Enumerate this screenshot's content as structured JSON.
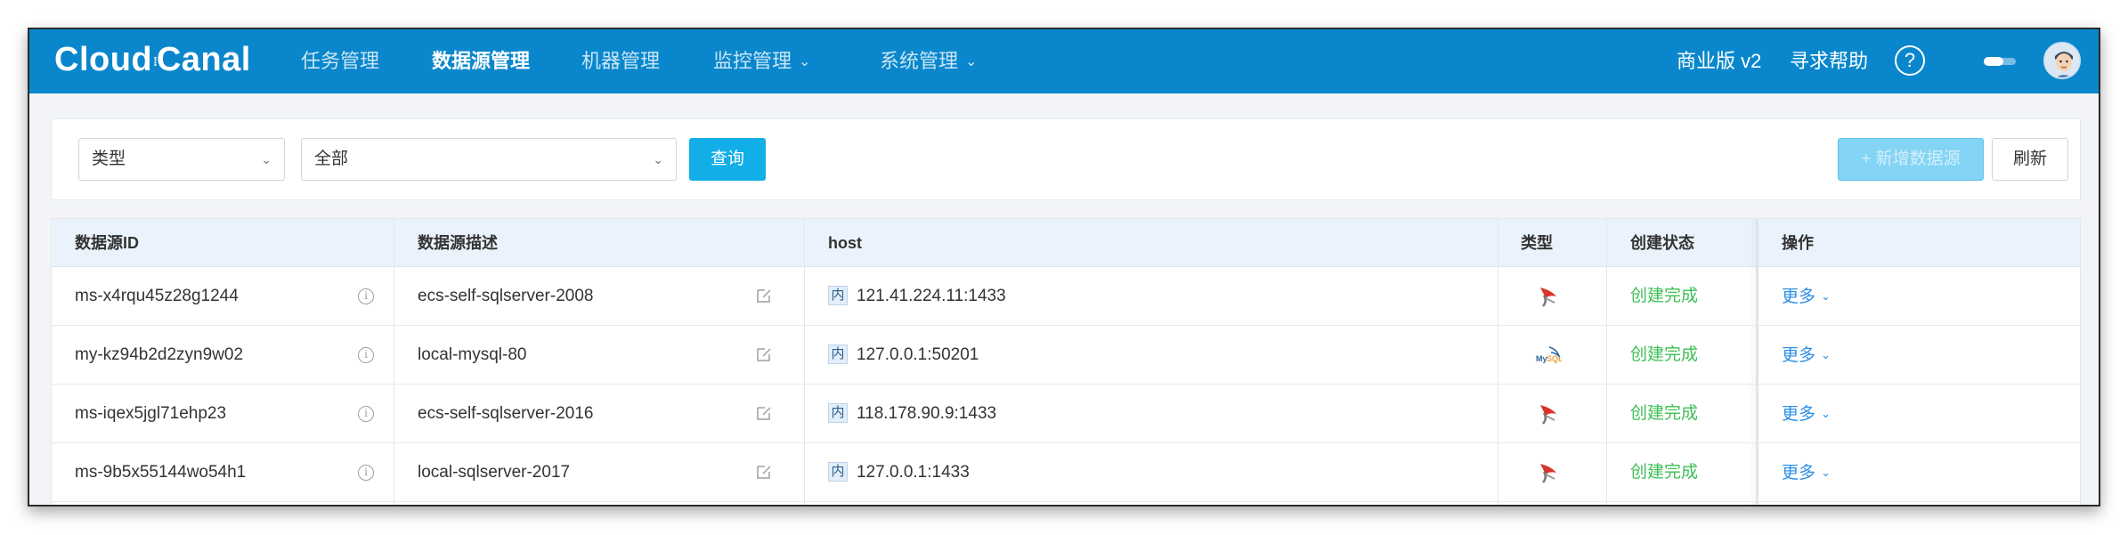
{
  "app": {
    "logo": "Cloud:Canal",
    "logo_left": "Cloud",
    "logo_right": "Canal"
  },
  "nav": {
    "items": [
      {
        "label": "任务管理",
        "active": false,
        "dropdown": false
      },
      {
        "label": "数据源管理",
        "active": true,
        "dropdown": false
      },
      {
        "label": "机器管理",
        "active": false,
        "dropdown": false
      },
      {
        "label": "监控管理",
        "active": false,
        "dropdown": true
      },
      {
        "label": "系统管理",
        "active": false,
        "dropdown": true
      }
    ],
    "edition": "商业版 v2",
    "help": "寻求帮助",
    "help_icon": "?"
  },
  "filter": {
    "type_select": "类型",
    "value_select": "全部",
    "query_button": "查询",
    "add_button": "+ 新增数据源",
    "refresh_button": "刷新"
  },
  "table": {
    "headers": {
      "id": "数据源ID",
      "desc": "数据源描述",
      "host": "host",
      "type": "类型",
      "status": "创建状态",
      "ops": "操作"
    },
    "rows": [
      {
        "id": "ms-x4rqu45z28g1244",
        "desc": "ecs-self-sqlserver-2008",
        "host_tag": "内",
        "host": "121.41.224.11:1433",
        "type_icon": "sqlserver-icon",
        "status": "创建完成",
        "ops": "更多"
      },
      {
        "id": "my-kz94b2d2zyn9w02",
        "desc": "local-mysql-80",
        "host_tag": "内",
        "host": "127.0.0.1:50201",
        "type_icon": "mysql-icon",
        "status": "创建完成",
        "ops": "更多"
      },
      {
        "id": "ms-iqex5jgl71ehp23",
        "desc": "ecs-self-sqlserver-2016",
        "host_tag": "内",
        "host": "118.178.90.9:1433",
        "type_icon": "sqlserver-icon",
        "status": "创建完成",
        "ops": "更多"
      },
      {
        "id": "ms-9b5x55144wo54h1",
        "desc": "local-sqlserver-2017",
        "host_tag": "内",
        "host": "127.0.0.1:1433",
        "type_icon": "sqlserver-icon",
        "status": "创建完成",
        "ops": "更多"
      }
    ]
  },
  "colors": {
    "nav_bg": "#0a87cc",
    "primary": "#11aee7",
    "success": "#3dbf55",
    "link": "#2a8ee6",
    "header_bg": "#eaf3fb"
  }
}
